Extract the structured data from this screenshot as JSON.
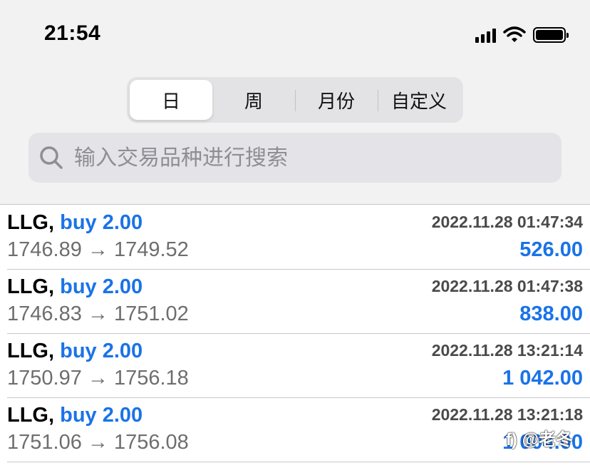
{
  "status_bar": {
    "time": "21:54"
  },
  "tabs": [
    "日",
    "周",
    "月份",
    "自定义"
  ],
  "search": {
    "placeholder": "输入交易品种进行搜索"
  },
  "trades": [
    {
      "symbol": "LLG,",
      "type": "buy 2.00",
      "time": "2022.11.28 01:47:34",
      "prices": "1746.89 → 1749.52",
      "profit": "526.00"
    },
    {
      "symbol": "LLG,",
      "type": "buy 2.00",
      "time": "2022.11.28 01:47:38",
      "prices": "1746.83 → 1751.02",
      "profit": "838.00"
    },
    {
      "symbol": "LLG,",
      "type": "buy 2.00",
      "time": "2022.11.28 13:21:14",
      "prices": "1750.97 → 1756.18",
      "profit": "1 042.00"
    },
    {
      "symbol": "LLG,",
      "type": "buy 2.00",
      "time": "2022.11.28 13:21:18",
      "prices": "1751.06 → 1756.08",
      "profit": "1 004.00"
    }
  ],
  "watermark": "f) @老冬",
  "colors": {
    "accent": "#1a73e8",
    "background": "#f2f2f2"
  }
}
